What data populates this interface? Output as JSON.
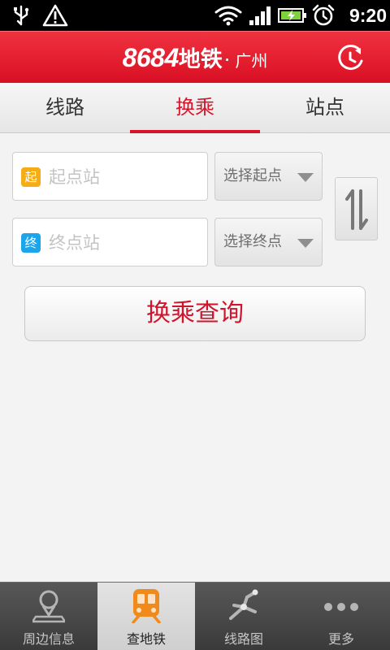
{
  "status_bar": {
    "time": "9:20"
  },
  "header": {
    "brand": "8684",
    "brand_suffix": "地铁",
    "separator": "·",
    "city": "广州"
  },
  "tabs": [
    {
      "label": "线路",
      "active": false
    },
    {
      "label": "换乘",
      "active": true
    },
    {
      "label": "站点",
      "active": false
    }
  ],
  "form": {
    "start": {
      "badge": "起",
      "placeholder": "起点站",
      "value": "",
      "select_label": "选择起点"
    },
    "end": {
      "badge": "终",
      "placeholder": "终点站",
      "value": "",
      "select_label": "选择终点"
    },
    "query_label": "换乘查询"
  },
  "bottom_nav": [
    {
      "label": "周边信息",
      "icon": "map-pin-icon",
      "active": false
    },
    {
      "label": "查地铁",
      "icon": "metro-train-icon",
      "active": true
    },
    {
      "label": "线路图",
      "icon": "route-map-icon",
      "active": false
    },
    {
      "label": "更多",
      "icon": "more-dots-icon",
      "active": false
    }
  ],
  "colors": {
    "brand_red": "#d90f23",
    "active_tab": "#d8142a",
    "start_badge": "#f6ad15",
    "end_badge": "#1ca5ea",
    "train_orange": "#f08a1c"
  }
}
